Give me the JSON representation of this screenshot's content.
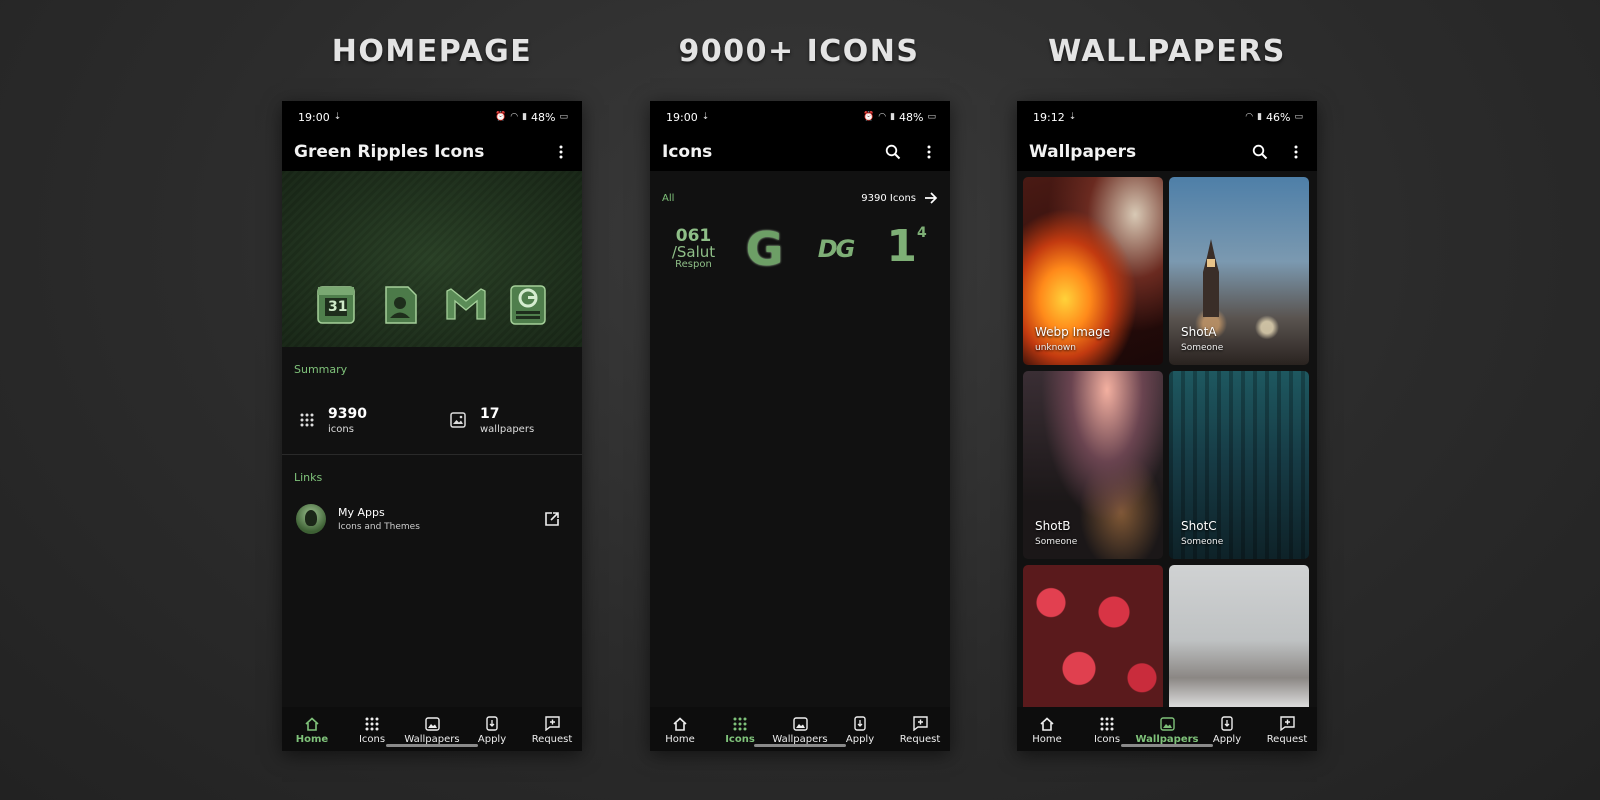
{
  "sections": {
    "homepage": "HOMEPAGE",
    "icons": "9000+ ICONS",
    "wallpapers": "WALLPAPERS"
  },
  "colors": {
    "accent": "#7fc27a",
    "appbar": "#000000",
    "surface": "#111111"
  },
  "phone1": {
    "status": {
      "time": "19:00",
      "battery": "48%"
    },
    "title": "Green Ripples Icons",
    "banner_icons": [
      "calendar-icon",
      "contacts-icon",
      "gmail-icon",
      "gboard-icon"
    ],
    "calendar_number": "31",
    "summary_label": "Summary",
    "summary": {
      "icons_count": "9390",
      "icons_label": "icons",
      "wallpapers_count": "17",
      "wallpapers_label": "wallpapers"
    },
    "links_label": "Links",
    "link": {
      "title": "My Apps",
      "subtitle": "Icons and Themes"
    },
    "nav_active": "Home"
  },
  "phone2": {
    "status": {
      "time": "19:00",
      "battery": "48%"
    },
    "title": "Icons",
    "filter": "All",
    "count": "9390 Icons",
    "icon_samples": {
      "first_line1": "061",
      "first_line2": "/Salut",
      "first_line3": "Respon",
      "second": "G",
      "third": "DG",
      "fourth": "1",
      "fourth_sup": "4"
    },
    "nav_active": "Icons"
  },
  "phone3": {
    "status": {
      "time": "19:12",
      "battery": "46%"
    },
    "title": "Wallpapers",
    "wallpapers": [
      {
        "title": "Webp Image",
        "author": "unknown"
      },
      {
        "title": "ShotA",
        "author": "Someone"
      },
      {
        "title": "ShotB",
        "author": "Someone"
      },
      {
        "title": "ShotC",
        "author": "Someone"
      },
      {
        "title": "",
        "author": ""
      },
      {
        "title": "",
        "author": ""
      }
    ],
    "nav_active": "Wallpapers"
  },
  "nav": {
    "home": "Home",
    "icons": "Icons",
    "wallpapers": "Wallpapers",
    "apply": "Apply",
    "request": "Request"
  }
}
